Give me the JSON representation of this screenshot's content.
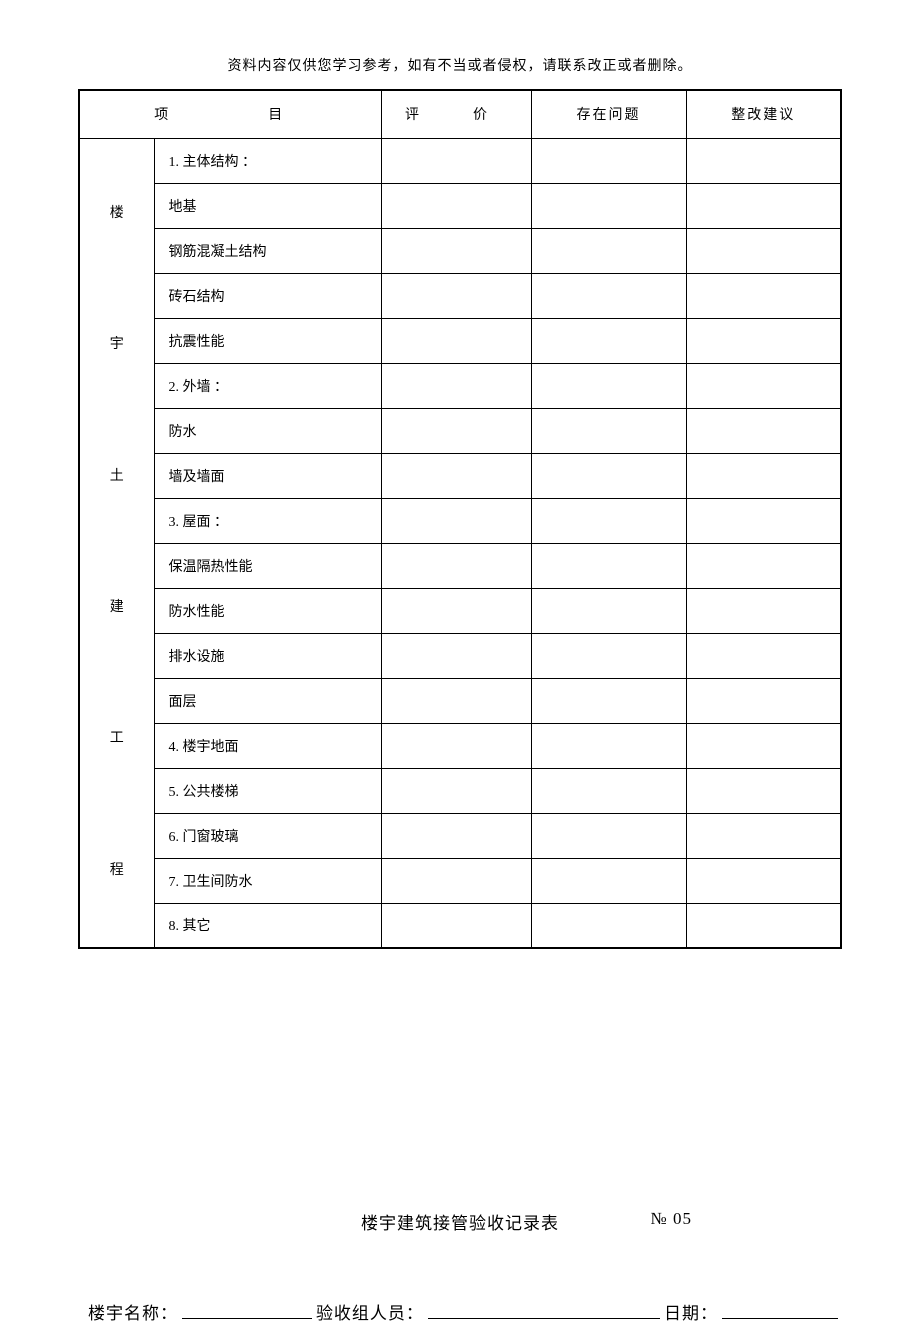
{
  "disclaimer": "资料内容仅供您学习参考，如有不当或者侵权，请联系改正或者删除。",
  "table": {
    "headers": {
      "project": "项　　目",
      "evaluation": "评　价",
      "issues": "存在问题",
      "suggestions": "整改建议"
    },
    "side_label_chars": [
      "楼",
      "宇",
      "土",
      "建",
      "工",
      "程"
    ],
    "rows": [
      {
        "label": "1. 主体结构 ：",
        "evaluation": "",
        "issues": "",
        "suggestions": ""
      },
      {
        "label": "地基",
        "evaluation": "",
        "issues": "",
        "suggestions": ""
      },
      {
        "label": "钢筋混凝土结构",
        "evaluation": "",
        "issues": "",
        "suggestions": ""
      },
      {
        "label": "砖石结构",
        "evaluation": "",
        "issues": "",
        "suggestions": ""
      },
      {
        "label": "抗震性能",
        "evaluation": "",
        "issues": "",
        "suggestions": ""
      },
      {
        "label": "2. 外墙 ：",
        "evaluation": "",
        "issues": "",
        "suggestions": ""
      },
      {
        "label": "防水",
        "evaluation": "",
        "issues": "",
        "suggestions": ""
      },
      {
        "label": "墙及墙面",
        "evaluation": "",
        "issues": "",
        "suggestions": ""
      },
      {
        "label": "3. 屋面 ：",
        "evaluation": "",
        "issues": "",
        "suggestions": ""
      },
      {
        "label": "保温隔热性能",
        "evaluation": "",
        "issues": "",
        "suggestions": ""
      },
      {
        "label": "防水性能",
        "evaluation": "",
        "issues": "",
        "suggestions": ""
      },
      {
        "label": "排水设施",
        "evaluation": "",
        "issues": "",
        "suggestions": ""
      },
      {
        "label": "面层",
        "evaluation": "",
        "issues": "",
        "suggestions": ""
      },
      {
        "label": "4. 楼宇地面",
        "evaluation": "",
        "issues": "",
        "suggestions": ""
      },
      {
        "label": "5. 公共楼梯",
        "evaluation": "",
        "issues": "",
        "suggestions": ""
      },
      {
        "label": "6. 门窗玻璃",
        "evaluation": "",
        "issues": "",
        "suggestions": ""
      },
      {
        "label": "7. 卫生间防水",
        "evaluation": "",
        "issues": "",
        "suggestions": ""
      },
      {
        "label": "8. 其它",
        "evaluation": "",
        "issues": "",
        "suggestions": ""
      }
    ]
  },
  "footer": {
    "form_title": "楼宇建筑接管验收记录表",
    "form_number": "№ 05",
    "building_name_label": "楼宇名称：",
    "inspector_label": "验收组人员：",
    "date_label": "日期："
  }
}
